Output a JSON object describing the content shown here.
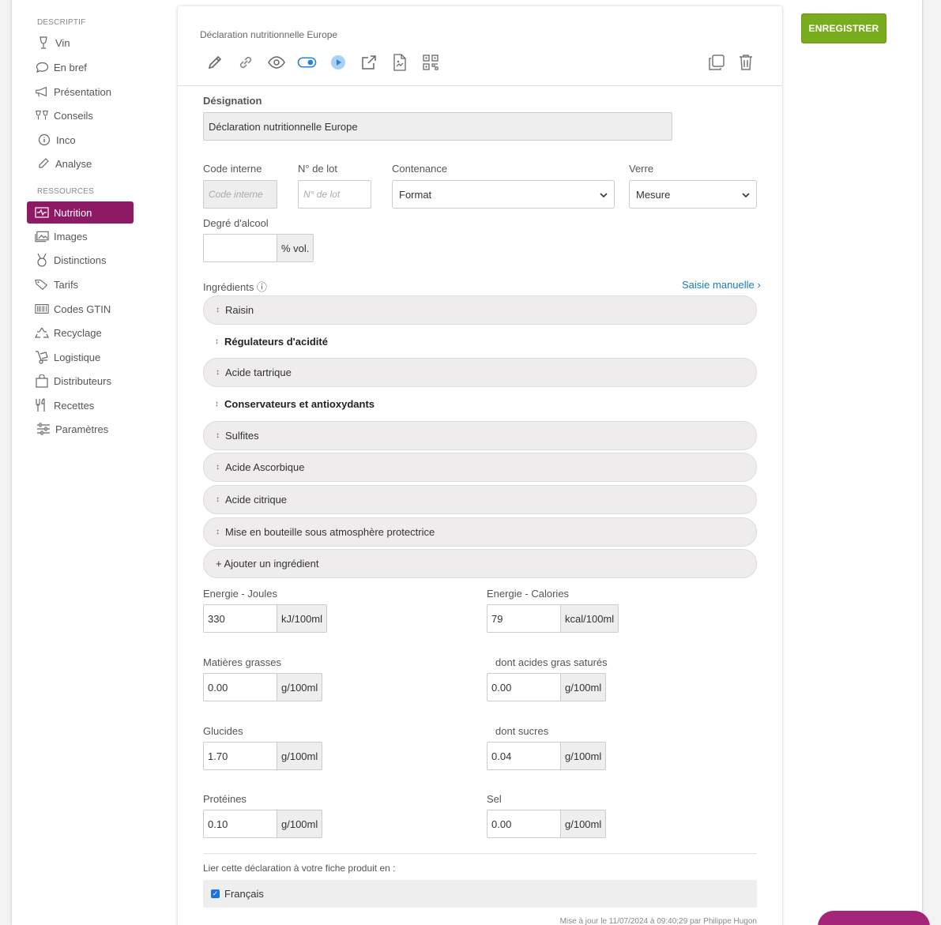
{
  "sidebar": {
    "section_descriptif": "DESCRIPTIF",
    "section_ressources": "RESSOURCES",
    "items": [
      {
        "label": "Vin",
        "icon": "wine-glass-icon"
      },
      {
        "label": "En bref",
        "icon": "speech-bubble-icon"
      },
      {
        "label": "Présentation",
        "icon": "megaphone-icon"
      },
      {
        "label": "Conseils",
        "icon": "cheers-glasses-icon"
      },
      {
        "label": "Inco",
        "icon": "info-circle-icon"
      },
      {
        "label": "Analyse",
        "icon": "pipette-icon"
      },
      {
        "label": "Nutrition",
        "icon": "pulse-icon",
        "active": true
      },
      {
        "label": "Images",
        "icon": "images-icon"
      },
      {
        "label": "Distinctions",
        "icon": "medal-icon"
      },
      {
        "label": "Tarifs",
        "icon": "price-tags-icon"
      },
      {
        "label": "Codes GTIN",
        "icon": "barcode-icon"
      },
      {
        "label": "Recyclage",
        "icon": "recycle-icon"
      },
      {
        "label": "Logistique",
        "icon": "hand-truck-icon"
      },
      {
        "label": "Distributeurs",
        "icon": "shopping-bag-icon"
      },
      {
        "label": "Recettes",
        "icon": "cutlery-icon"
      },
      {
        "label": "Paramètres",
        "icon": "sliders-icon"
      }
    ]
  },
  "header": {
    "title": "Déclaration nutritionnelle Europe",
    "save_label": "ENREGISTRER"
  },
  "form": {
    "designation_label": "Désignation",
    "designation_value": "Déclaration nutritionnelle Europe",
    "code_interne_label": "Code interne",
    "code_interne_placeholder": "Code interne",
    "lot_label": "N° de lot",
    "lot_placeholder": "N° de lot",
    "contenance_label": "Contenance",
    "contenance_value": "Format",
    "verre_label": "Verre",
    "verre_value": "Mesure",
    "alcool_label": "Degré d'alcool",
    "alcool_value": "",
    "alcool_unit": "% vol.",
    "ingredients_label": "Ingrédients ⓘ",
    "saisie_manuelle": "Saisie manuelle ›"
  },
  "ingredients": {
    "raisin": "Raisin",
    "group_regulateurs": "Régulateurs d'acidité",
    "acide_tartrique": "Acide tartrique",
    "group_conservateurs": "Conservateurs et antioxydants",
    "sulfites": "Sulfites",
    "acide_ascorbique": "Acide Ascorbique",
    "acide_citrique": "Acide citrique",
    "mise_bouteille": "Mise en bouteille sous atmosphère protectrice",
    "add": "+ Ajouter un ingrédient"
  },
  "nutrition": {
    "energie_joules": {
      "label": "Energie - Joules",
      "value": "330",
      "unit": "kJ/100ml"
    },
    "energie_calories": {
      "label": "Energie - Calories",
      "value": "79",
      "unit": "kcal/100ml"
    },
    "matieres_grasses": {
      "label": "Matières grasses",
      "value": "0.00",
      "unit": "g/100ml"
    },
    "acides_gras": {
      "label": "dont acides gras saturés",
      "value": "0.00",
      "unit": "g/100ml"
    },
    "glucides": {
      "label": "Glucides",
      "value": "1.70",
      "unit": "g/100ml"
    },
    "sucres": {
      "label": "dont sucres",
      "value": "0.04",
      "unit": "g/100ml"
    },
    "proteines": {
      "label": "Protéines",
      "value": "0.10",
      "unit": "g/100ml"
    },
    "sel": {
      "label": "Sel",
      "value": "0.00",
      "unit": "g/100ml"
    }
  },
  "link_section": {
    "label": "Lier cette déclaration à votre fiche produit en :",
    "language": "Français",
    "checked": true
  },
  "footer": {
    "updated": "Mise à jour le 11/07/2024 à 09:40:29 par Philippe Hugon"
  },
  "colors": {
    "active": "#8e1a66",
    "save": "#7aad1e",
    "link": "#1a7bb9"
  }
}
